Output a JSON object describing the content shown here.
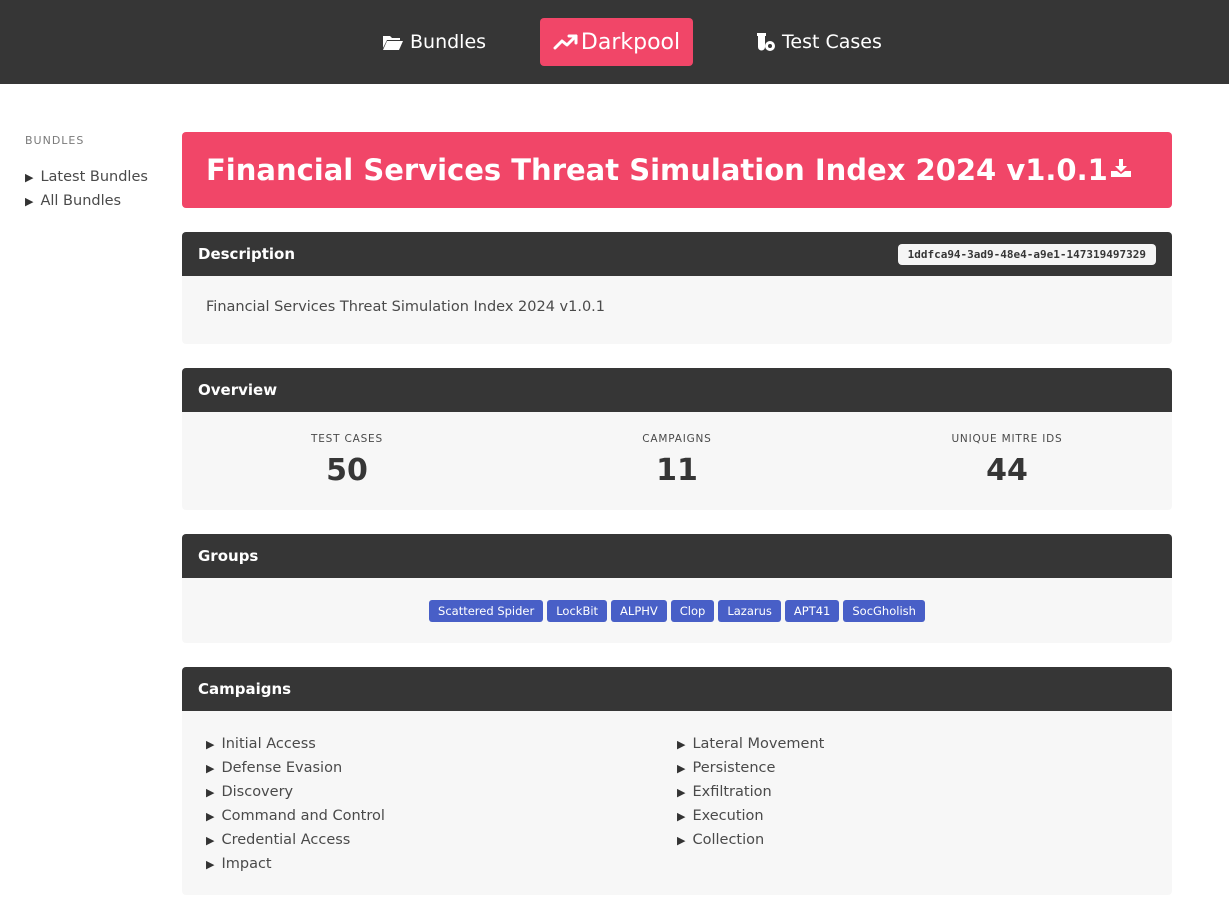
{
  "nav": {
    "bundles": {
      "label": "Bundles",
      "icon": "folder-open-icon"
    },
    "darkpool": {
      "label": "Darkpool",
      "icon": "trending-up-icon"
    },
    "test_cases": {
      "label": "Test Cases",
      "icon": "vial-gear-icon"
    }
  },
  "sidebar": {
    "label": "BUNDLES",
    "items": [
      {
        "label": "Latest Bundles"
      },
      {
        "label": "All Bundles"
      }
    ]
  },
  "hero": {
    "title": "Financial Services Threat Simulation Index 2024 v1.0.1",
    "download_icon": "download-icon"
  },
  "description": {
    "header": "Description",
    "id": "1ddfca94-3ad9-48e4-a9e1-147319497329",
    "text": "Financial Services Threat Simulation Index 2024 v1.0.1"
  },
  "overview": {
    "header": "Overview",
    "stats": [
      {
        "label": "TEST CASES",
        "value": "50"
      },
      {
        "label": "CAMPAIGNS",
        "value": "11"
      },
      {
        "label": "UNIQUE MITRE IDS",
        "value": "44"
      }
    ]
  },
  "groups": {
    "header": "Groups",
    "tags": [
      "Scattered Spider",
      "LockBit",
      "ALPHV",
      "Clop",
      "Lazarus",
      "APT41",
      "SocGholish"
    ]
  },
  "campaigns": {
    "header": "Campaigns",
    "left": [
      "Initial Access",
      "Defense Evasion",
      "Discovery",
      "Command and Control",
      "Credential Access",
      "Impact"
    ],
    "right": [
      "Lateral Movement",
      "Persistence",
      "Exfiltration",
      "Execution",
      "Collection"
    ]
  },
  "colors": {
    "primary": "#f14668",
    "dark": "#363636",
    "link": "#485fc7",
    "card_bg": "#f7f7f7"
  }
}
